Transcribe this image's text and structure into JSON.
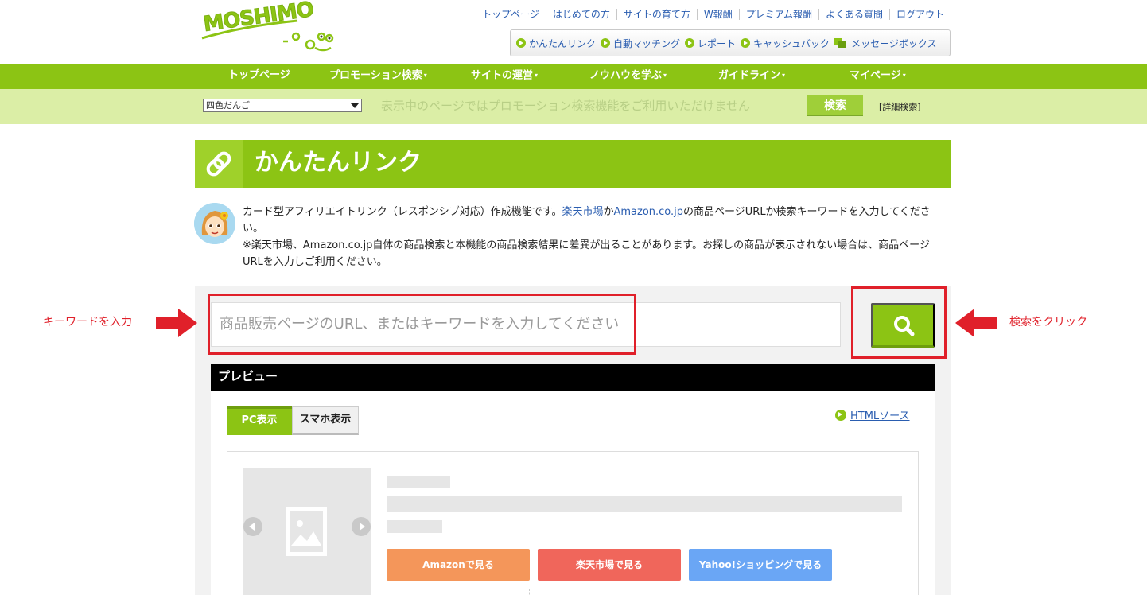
{
  "header": {
    "logo_text": "MOSHIMO",
    "top_links": [
      "トップページ",
      "はじめての方",
      "サイトの育て方",
      "W報酬",
      "プレミアム報酬",
      "よくある質問",
      "ログアウト"
    ],
    "sub_links": [
      "かんたんリンク",
      "自動マッチング",
      "レポート",
      "キャッシュバック",
      "メッセージボックス"
    ]
  },
  "main_nav": {
    "items": [
      "トップページ",
      "プロモーション検索",
      "サイトの運営",
      "ノウハウを学ぶ",
      "ガイドライン",
      "マイページ"
    ],
    "caret": "▾"
  },
  "search_strip": {
    "site_select_value": "四色だんご",
    "message": "表示中のページではプロモーション検索機能をご利用いただけません",
    "search_button": "検索",
    "advanced_link": "[詳細検索]"
  },
  "page_title": "かんたんリンク",
  "intro": {
    "line1_a": "カード型アフィリエイトリンク（レスポンシブ対応）作成機能です。",
    "link_rakuten": "楽天市場",
    "ka": "か",
    "link_amazon": "Amazon.co.jp",
    "line1_b": "の商品ページURLか検索キーワードを入力してください。",
    "note": "※楽天市場、Amazon.co.jp自体の商品検索と本機能の商品検索結果に差異が出ることがあります。お探しの商品が表示されない場合は、商品ページURLを入力しご利用ください。"
  },
  "search": {
    "placeholder": "商品販売ページのURL、またはキーワードを入力してください",
    "button_icon": "search-icon"
  },
  "annotations": {
    "left": "キーワードを入力",
    "right": "検索をクリック",
    "color": "#e0202a"
  },
  "preview": {
    "heading": "プレビュー",
    "tabs": [
      "PC表示",
      "スマホ表示"
    ],
    "active_tab": "PC表示",
    "html_source_link": "HTMLソース",
    "shop_buttons": [
      "Amazonで見る",
      "楽天市場で見る",
      "Yahoo!ショッピングで見る"
    ]
  },
  "colors": {
    "brand_green": "#8cc414",
    "strip_green": "#dbeea6",
    "link_blue": "#2a5db0",
    "amazon": "#f4965a",
    "rakuten": "#f0665b",
    "yahoo": "#6aa6f5"
  }
}
